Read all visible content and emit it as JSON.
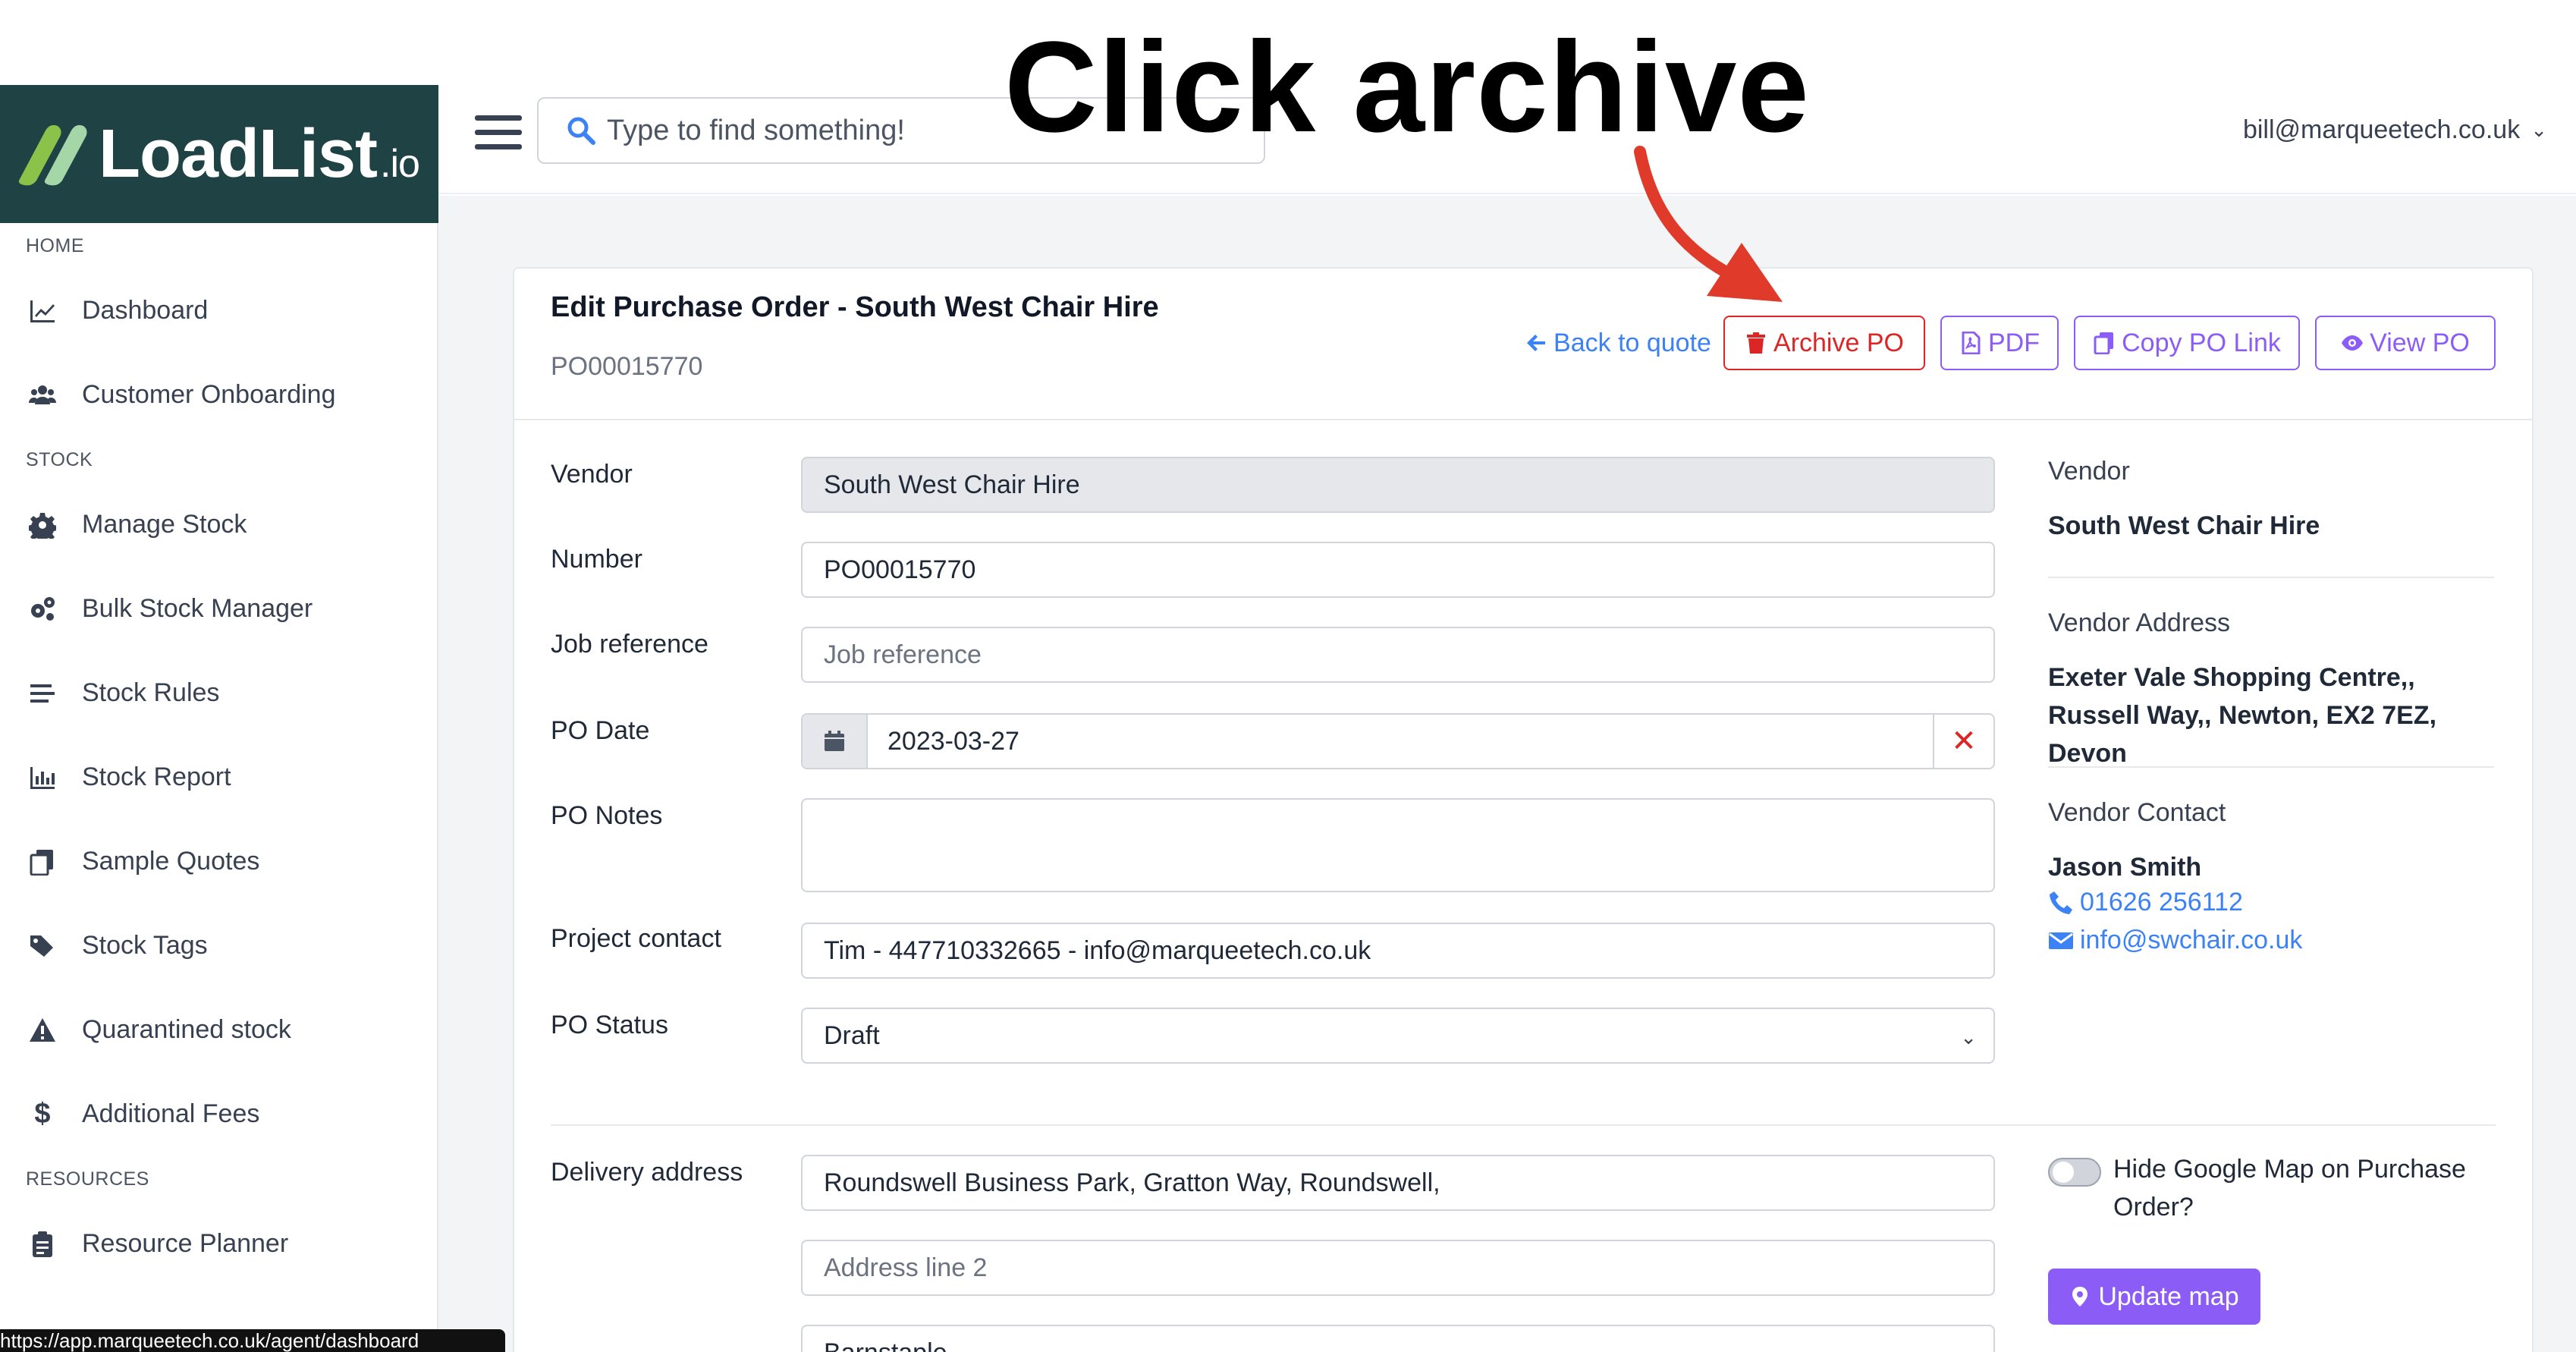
{
  "banner": {
    "text": "Click archive"
  },
  "sidebar": {
    "logo_text": "LoadList",
    "logo_suffix": ".io",
    "sections": {
      "home": "HOME",
      "stock": "STOCK",
      "resources": "RESOURCES"
    },
    "items": [
      {
        "label": "Dashboard",
        "icon": "chart-line-icon"
      },
      {
        "label": "Customer Onboarding",
        "icon": "users-icon"
      },
      {
        "label": "Manage Stock",
        "icon": "gear-icon"
      },
      {
        "label": "Bulk Stock Manager",
        "icon": "gears-icon"
      },
      {
        "label": "Stock Rules",
        "icon": "lines-icon"
      },
      {
        "label": "Stock Report",
        "icon": "bar-chart-icon"
      },
      {
        "label": "Sample Quotes",
        "icon": "copy-icon"
      },
      {
        "label": "Stock Tags",
        "icon": "tags-icon"
      },
      {
        "label": "Quarantined stock",
        "icon": "warning-icon"
      },
      {
        "label": "Additional Fees",
        "icon": "dollar-icon"
      },
      {
        "label": "Resource Planner",
        "icon": "clipboard-icon"
      }
    ]
  },
  "topbar": {
    "search_placeholder": "Type to find something!",
    "user_email": "bill@marqueetech.co.uk"
  },
  "header": {
    "title": "Edit Purchase Order - South West Chair Hire",
    "po_number": "PO00015770",
    "back_label": "Back to quote",
    "archive_label": "Archive PO",
    "pdf_label": "PDF",
    "copy_label": "Copy PO Link",
    "view_label": "View PO"
  },
  "form": {
    "vendor_label": "Vendor",
    "vendor_value": "South West Chair Hire",
    "number_label": "Number",
    "number_value": "PO00015770",
    "jobref_label": "Job reference",
    "jobref_placeholder": "Job reference",
    "podate_label": "PO Date",
    "podate_value": "2023-03-27",
    "ponotes_label": "PO Notes",
    "ponotes_value": "",
    "contact_label": "Project contact",
    "contact_value": "Tim - 447710332665 - info@marqueetech.co.uk",
    "status_label": "PO Status",
    "status_value": "Draft",
    "delivery_label": "Delivery address",
    "address1_value": "Roundswell Business Park, Gratton Way, Roundswell,",
    "address2_placeholder": "Address line 2",
    "city_value": "Barnstaple"
  },
  "vendor_panel": {
    "vendor_label": "Vendor",
    "vendor_name": "South West Chair Hire",
    "address_label": "Vendor Address",
    "address_value": "Exeter Vale Shopping Centre,, Russell Way,, Newton, EX2 7EZ, Devon",
    "contact_label": "Vendor Contact",
    "contact_name": "Jason Smith",
    "contact_phone": "01626 256112",
    "contact_email": "info@swchair.co.uk",
    "hide_map_label": "Hide Google Map on Purchase Order?",
    "update_map_label": "Update map"
  },
  "status_bar": {
    "url": "https://app.marqueetech.co.uk/agent/dashboard"
  },
  "colors": {
    "logo_bg": "#1f4244",
    "archive": "#dc2626",
    "purple": "#8b5cf6",
    "link": "#3b82f6",
    "arrow": "#e03a2a"
  }
}
